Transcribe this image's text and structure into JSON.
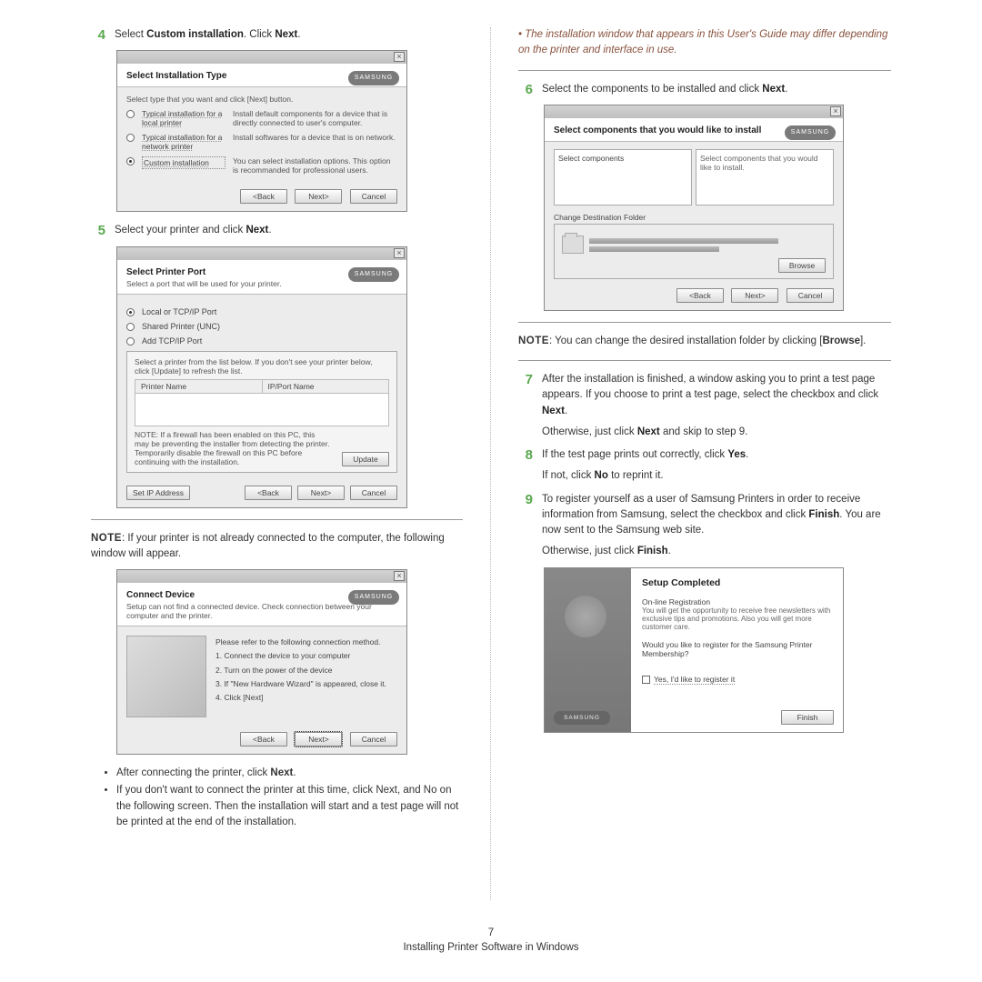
{
  "footer": {
    "page_number": "7",
    "title": "Installing Printer Software in Windows"
  },
  "left": {
    "step4": {
      "num": "4",
      "text_pre": "Select ",
      "bold": "Custom installation",
      "text_post": ". Click ",
      "bold2": "Next",
      "text_end": "."
    },
    "dlg1": {
      "title": "Select Installation Type",
      "instruction": "Select type that you want and click [Next] button.",
      "samsung": "SAMSUNG",
      "opt1_label": "Typical installation for a local printer",
      "opt1_desc": "Install default components for a device that is directly connected to user's computer.",
      "opt2_label": "Typical installation for a network printer",
      "opt2_desc": "Install softwares for a device that is on network.",
      "opt3_label": "Custom installation",
      "opt3_desc": "You can select installation options. This option is recommanded for professional users.",
      "back": "<Back",
      "next": "Next>",
      "cancel": "Cancel"
    },
    "step5": {
      "num": "5",
      "text_pre": "Select your printer and click ",
      "bold": "Next",
      "text_end": "."
    },
    "dlg2": {
      "title": "Select Printer Port",
      "sub": "Select a port that will be used for your printer.",
      "r1": "Local or TCP/IP Port",
      "r2": "Shared Printer (UNC)",
      "r3": "Add TCP/IP Port",
      "panel_hint": "Select a printer from the list below. If you don't see your printer below, click [Update] to refresh the list.",
      "col1": "Printer Name",
      "col2": "IP/Port Name",
      "panel_note": "NOTE: If a firewall has been enabled on this PC, this may be preventing the installer from detecting the printer. Temporarily disable the firewall on this PC before continuing with the installation.",
      "update": "Update",
      "setip": "Set IP Address",
      "samsung": "SAMSUNG",
      "back": "<Back",
      "next": "Next>",
      "cancel": "Cancel"
    },
    "note1_pre": "NOTE",
    "note1_text": ": If your printer is not already connected to the computer, the following window will appear.",
    "dlg3": {
      "title": "Connect Device",
      "sub": "Setup can not find a connected device. Check connection between your computer and the printer.",
      "samsung": "SAMSUNG",
      "intro": "Please refer to the following connection method.",
      "s1": "1. Connect the device to your computer",
      "s2": "2. Turn on the power of the device",
      "s3": "3. If \"New Hardware Wizard\" is appeared, close it.",
      "s4": "4. Click [Next]",
      "back": "<Back",
      "next": "Next>",
      "cancel": "Cancel"
    },
    "b1_pre": "After connecting the printer, click ",
    "b1_bold": "Next",
    "b1_end": ".",
    "b2": "If you don't want to connect the printer at this time, click Next, and No on the following screen. Then the installation will start and a test page will not be printed at the end of the installation."
  },
  "right": {
    "italic_note": "• The installation window that appears in this User's Guide may differ depending on the printer and interface in use.",
    "step6": {
      "num": "6",
      "text_pre": "Select the components to be installed and click ",
      "bold": "Next",
      "end": "."
    },
    "dlg4": {
      "title": "Select components that you would like to install",
      "samsung": "SAMSUNG",
      "left_label": "Select components",
      "right_hint": "Select components that you would like to install.",
      "change_label": "Change Destination Folder",
      "browse": "Browse",
      "back": "<Back",
      "next": "Next>",
      "cancel": "Cancel"
    },
    "note2_pre": "NOTE",
    "note2_text": ": You can change the desired installation folder by clicking [",
    "note2_bold": "Browse",
    "note2_end": "].",
    "step7": {
      "num": "7",
      "line1": "After the installation is finished, a window asking you to print a test page appears. If you choose to print a test page, select the checkbox and click ",
      "bold": "Next",
      "end": ".",
      "line2_pre": "Otherwise, just click ",
      "line2_bold": "Next",
      "line2_end": " and skip to step 9."
    },
    "step8": {
      "num": "8",
      "l1_pre": "If the test page prints out correctly, click ",
      "l1_bold": "Yes",
      "l1_end": ".",
      "l2_pre": "If not, click ",
      "l2_bold": "No",
      "l2_end": " to reprint it."
    },
    "step9": {
      "num": "9",
      "l1_pre": "To register yourself as a user of Samsung Printers in order to receive information from Samsung, select the checkbox and click ",
      "l1_bold": "Finish",
      "l1_end": ". You are now sent to the Samsung web site.",
      "l2_pre": "Otherwise, just click ",
      "l2_bold": "Finish",
      "l2_end": "."
    },
    "dlg5": {
      "title": "Setup Completed",
      "samsung": "SAMSUNG",
      "reg_head": "On-line Registration",
      "reg_body": "You will get the opportunity to receive free newsletters with exclusive tips and promotions. Also you will get more customer care.",
      "q": "Would you like to register for the Samsung Printer Membership?",
      "chk_label": "Yes, I'd like to register it",
      "finish": "Finish"
    }
  }
}
